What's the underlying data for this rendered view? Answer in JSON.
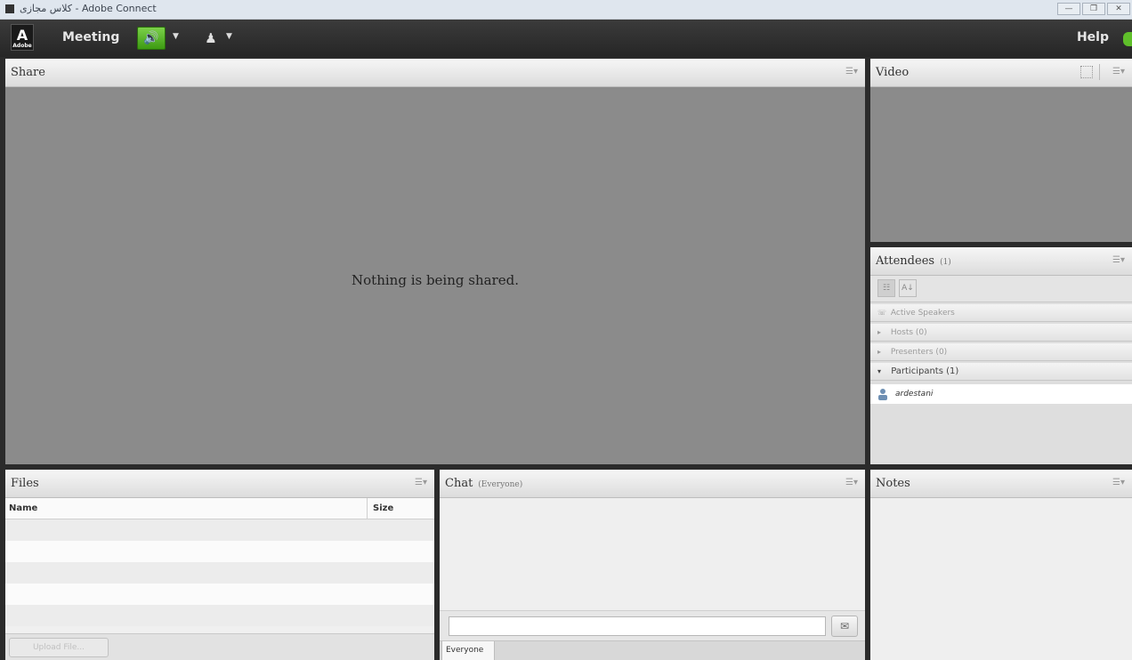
{
  "window": {
    "title": "کلاس مجازی - Adobe Connect",
    "controls": [
      "—",
      "❐",
      "✕"
    ]
  },
  "menubar": {
    "logo_text": "A",
    "logo_sub": "Adobe",
    "meeting_label": "Meeting",
    "speaker_icon": "speaker-icon",
    "camera_icon": "person-icon",
    "help_label": "Help",
    "status_color": "#5fbf2a"
  },
  "share": {
    "title": "Share",
    "empty_message": "Nothing is being shared."
  },
  "video": {
    "title": "Video"
  },
  "attendees": {
    "title": "Attendees",
    "count": "(1)",
    "sections": {
      "active_speakers": "Active Speakers",
      "hosts": "Hosts (0)",
      "presenters": "Presenters (0)",
      "participants": "Participants (1)"
    },
    "users": [
      {
        "name": "ardestani"
      }
    ]
  },
  "files": {
    "title": "Files",
    "columns": {
      "name": "Name",
      "size": "Size"
    },
    "upload_label": "Upload File..."
  },
  "chat": {
    "title": "Chat",
    "scope": "(Everyone)",
    "tab_everyone": "Everyone"
  },
  "notes": {
    "title": "Notes"
  },
  "theme": {
    "accent": "#4caf1c",
    "pod_header": "#e8e8e8",
    "stage_gray": "#8b8b8b"
  }
}
